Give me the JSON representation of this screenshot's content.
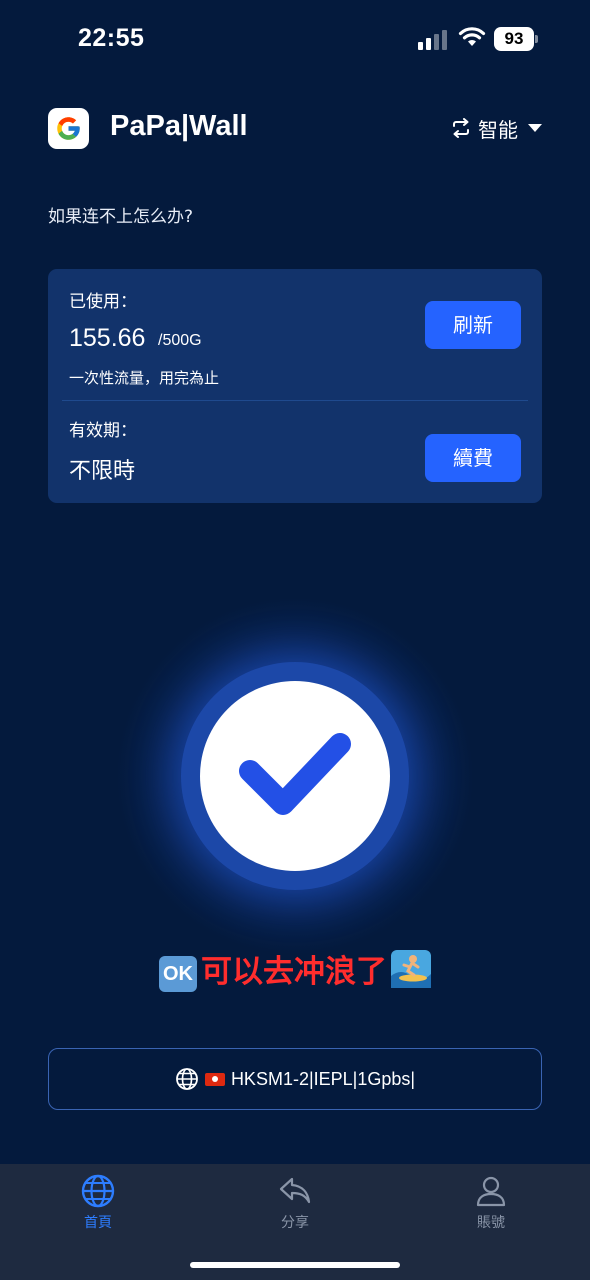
{
  "status_bar": {
    "time": "22:55",
    "battery": "93"
  },
  "header": {
    "app_title": "PaPa|Wall",
    "mode_label": "智能"
  },
  "help_link": "如果连不上怎么办?",
  "usage": {
    "used_label": "已使用：",
    "used_value": "155.66",
    "used_total": "/500G",
    "used_note": "一次性流量，用完為止",
    "refresh_label": "刷新",
    "validity_label": "有效期：",
    "validity_value": "不限時",
    "renew_label": "續費"
  },
  "status_message": {
    "ok_badge": "OK",
    "text": "可以去冲浪了"
  },
  "server": {
    "name": "HKSM1-2|IEPL|1Gpbs|"
  },
  "bottom_nav": [
    {
      "label": "首頁",
      "icon": "globe-icon",
      "active": true
    },
    {
      "label": "分享",
      "icon": "share-icon",
      "active": false
    },
    {
      "label": "賬號",
      "icon": "user-icon",
      "active": false
    }
  ],
  "colors": {
    "background": "#041a3d",
    "card": "#12336b",
    "accent": "#2563ff",
    "status_text": "#ff2d2d",
    "nav_active": "#2d7dff"
  }
}
